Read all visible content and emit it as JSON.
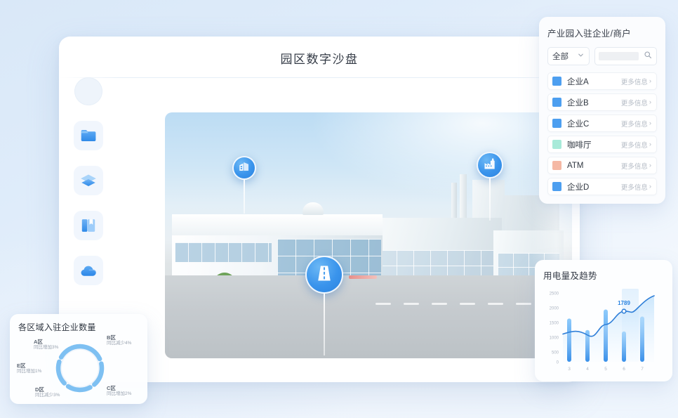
{
  "app": {
    "title": "园区数字沙盘"
  },
  "sidebar": {
    "items": [
      {
        "name": "avatar",
        "icon": "avatar-icon",
        "label": ""
      },
      {
        "name": "folder",
        "icon": "folder-icon",
        "label": ""
      },
      {
        "name": "layers",
        "icon": "layers-icon",
        "label": ""
      },
      {
        "name": "bookmark",
        "icon": "bookmark-icon",
        "label": ""
      },
      {
        "name": "cloud",
        "icon": "cloud-icon",
        "label": ""
      }
    ]
  },
  "scene": {
    "markers": [
      {
        "id": "office",
        "icon": "office-building-icon",
        "x": 115,
        "y": 66,
        "size": 34,
        "stem": 46
      },
      {
        "id": "factory",
        "icon": "factory-icon",
        "x": 463,
        "y": 62,
        "size": 38,
        "stem": 58
      },
      {
        "id": "road",
        "icon": "road-icon",
        "x": 227,
        "y": 212,
        "size": 54,
        "stem": 86
      }
    ]
  },
  "enterprise_panel": {
    "title": "产业园入驻企业/商户",
    "filter": {
      "selected": "全部",
      "chevron_icon": "chevron-down-icon"
    },
    "search": {
      "value": "",
      "placeholder": "",
      "icon": "search-icon"
    },
    "more_label": "更多信息",
    "more_chevron": "›",
    "items": [
      {
        "name": "企业A",
        "color": "#4d9ff0"
      },
      {
        "name": "企业B",
        "color": "#4d9ff0"
      },
      {
        "name": "企业C",
        "color": "#4d9ff0"
      },
      {
        "name": "咖啡厅",
        "color": "#a8ead9"
      },
      {
        "name": "ATM",
        "color": "#f5b8a4"
      },
      {
        "name": "企业D",
        "color": "#4d9ff0"
      }
    ]
  },
  "power_panel": {
    "title": "用电量及趋势"
  },
  "areas_panel": {
    "title": "各区域入驻企业数量",
    "labels": [
      {
        "area": "A区",
        "change": "同比增加3%"
      },
      {
        "area": "B区",
        "change": "同比减少4%"
      },
      {
        "area": "C区",
        "change": "同比增加2%"
      },
      {
        "area": "D区",
        "change": "同比减少3%"
      },
      {
        "area": "E区",
        "change": "同比增加1%"
      }
    ]
  },
  "chart_data": [
    {
      "type": "bar",
      "id": "power-usage",
      "title": "用电量及趋势",
      "categories": [
        "3",
        "4",
        "5",
        "6",
        "7"
      ],
      "series": [
        {
          "name": "用电量",
          "type": "bar",
          "values": [
            1480,
            1090,
            1790,
            1040,
            1550
          ]
        },
        {
          "name": "趋势",
          "type": "line",
          "values": [
            950,
            920,
            1290,
            1789,
            2120
          ]
        }
      ],
      "annotations": [
        {
          "text": "1789",
          "x": "6",
          "y": 1789,
          "color": "#2b83e0"
        }
      ],
      "xlabel": "",
      "ylabel": "",
      "ylim": [
        0,
        2500
      ],
      "yticks": [
        0,
        500,
        1000,
        1500,
        2000,
        2500
      ],
      "grid": false,
      "legend": "none"
    },
    {
      "type": "pie",
      "id": "area-enterprises",
      "title": "各区域入驻企业数量",
      "subtype": "donut",
      "categories": [
        "A区",
        "B区",
        "C区",
        "D区",
        "E区"
      ],
      "values": [
        20,
        20,
        20,
        20,
        20
      ],
      "annotations": [
        {
          "text": "同比增加3%",
          "category": "A区"
        },
        {
          "text": "同比减少4%",
          "category": "B区"
        },
        {
          "text": "同比增加2%",
          "category": "C区"
        },
        {
          "text": "同比减少3%",
          "category": "D区"
        },
        {
          "text": "同比增加1%",
          "category": "E区"
        }
      ],
      "colors": [
        "#7ec0f2",
        "#7ec0f2",
        "#7ec0f2",
        "#7ec0f2",
        "#7ec0f2"
      ],
      "legend": "around"
    }
  ]
}
